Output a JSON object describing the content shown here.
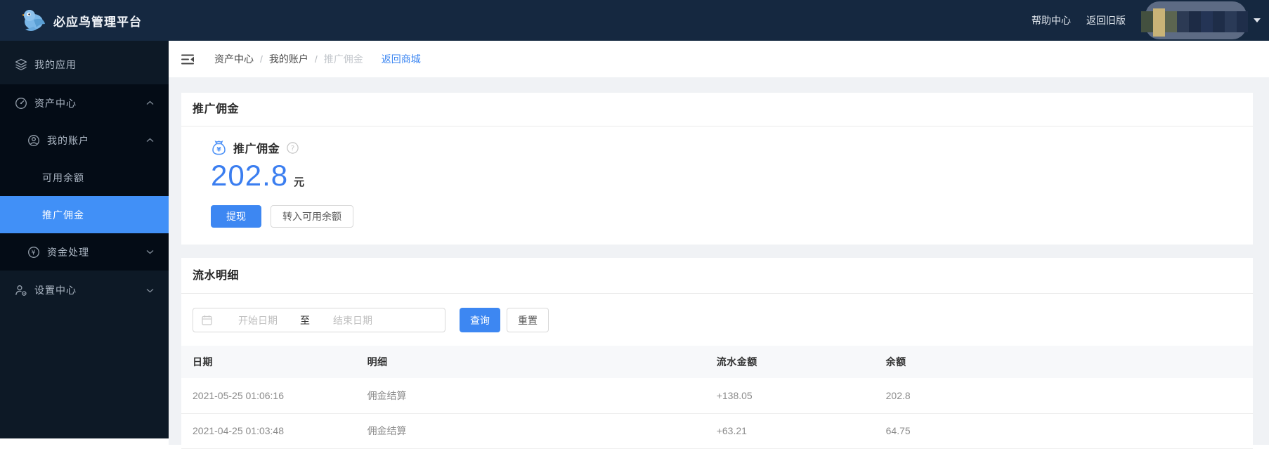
{
  "topbar": {
    "brand": "必应鸟管理平台",
    "help_link": "帮助中心",
    "back_old_link": "返回旧版"
  },
  "sidebar": {
    "items": [
      {
        "label": "我的应用",
        "icon": "layers-icon"
      },
      {
        "label": "资产中心",
        "icon": "dashboard-icon",
        "state": "expanded"
      },
      {
        "label": "我的账户",
        "icon": "user-circle-icon",
        "state": "expanded"
      },
      {
        "label": "可用余额"
      },
      {
        "label": "推广佣金",
        "selected": true
      },
      {
        "label": "资金处理",
        "icon": "yuan-circle-icon",
        "state": "collapsed"
      },
      {
        "label": "设置中心",
        "icon": "user-gear-icon",
        "state": "collapsed"
      }
    ]
  },
  "breadcrumb": {
    "level1": "资产中心",
    "separator": "/",
    "level2": "我的账户",
    "level3": "推广佣金",
    "back_link": "返回商城"
  },
  "commission": {
    "card_title": "推广佣金",
    "label": "推广佣金",
    "amount": "202.8",
    "unit": "元",
    "withdraw_button": "提现",
    "transfer_button": "转入可用余额"
  },
  "flow": {
    "card_title": "流水明细",
    "filter": {
      "start_placeholder": "开始日期",
      "range_separator": "至",
      "end_placeholder": "结束日期",
      "query_button": "查询",
      "reset_button": "重置"
    },
    "table": {
      "columns": [
        "日期",
        "明细",
        "流水金额",
        "余额"
      ],
      "rows": [
        [
          "2021-05-25 01:06:16",
          "佣金结算",
          "+138.05",
          "202.8"
        ],
        [
          "2021-04-25 01:03:48",
          "佣金结算",
          "+63.21",
          "64.75"
        ]
      ]
    }
  },
  "colors": {
    "primary_blue": "#3d87f2",
    "amount_blue": "#3b7ef0",
    "sidebar_selected": "#4190f7",
    "topbar_bg": "#152840",
    "sidebar_bg": "#0d1926",
    "sidebar_submenu_bg": "#040c16",
    "content_bg": "#f0f2f5"
  }
}
